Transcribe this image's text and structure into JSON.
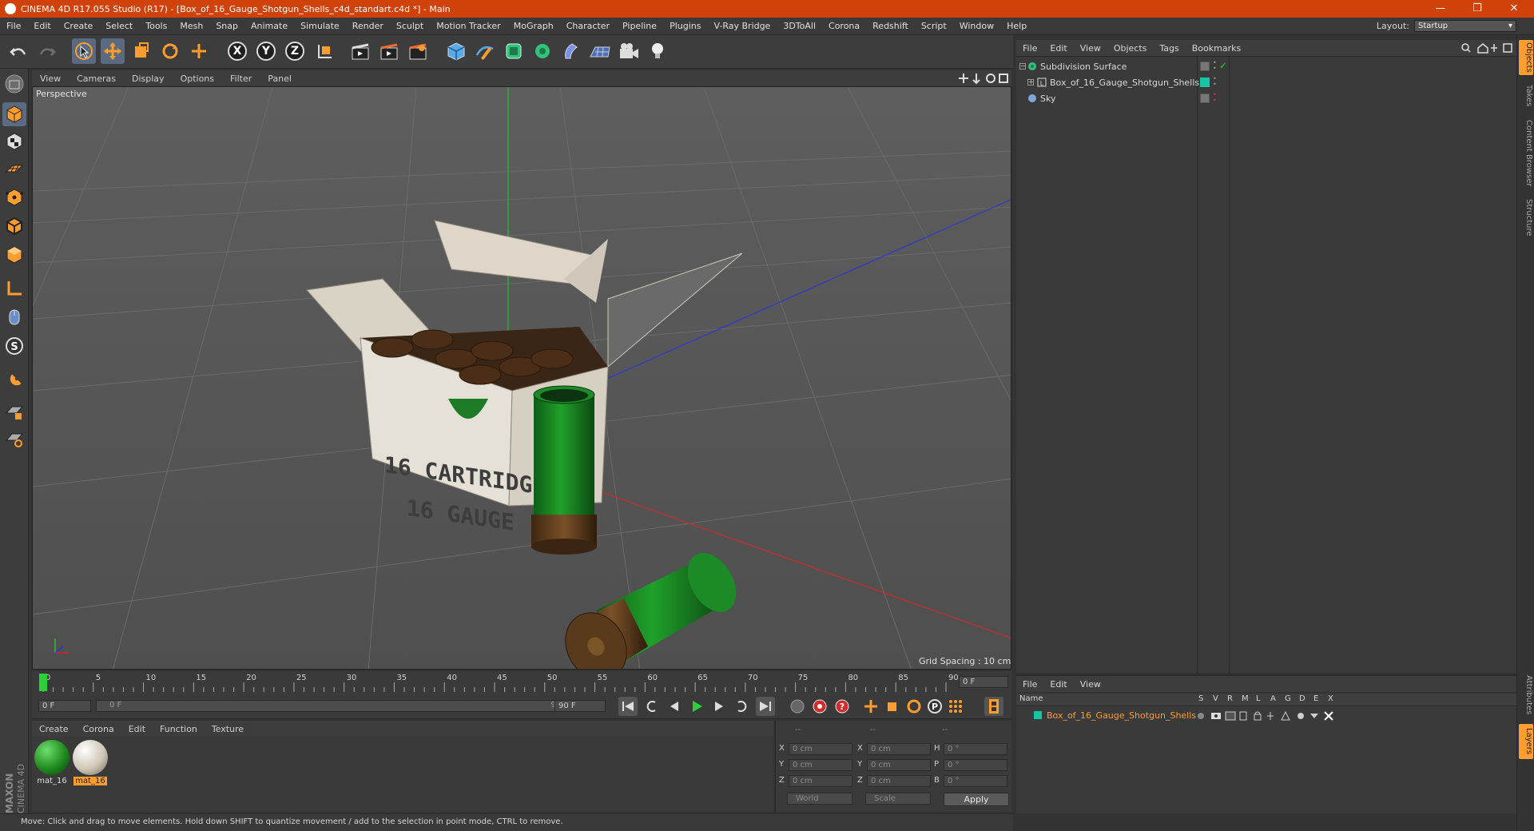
{
  "titlebar": {
    "title": "CINEMA 4D R17.055 Studio (R17) - [Box_of_16_Gauge_Shotgun_Shells_c4d_standart.c4d *] - Main",
    "minimize": "—",
    "restore": "❐",
    "close": "✕"
  },
  "menubar": {
    "items": [
      "File",
      "Edit",
      "Create",
      "Select",
      "Tools",
      "Mesh",
      "Snap",
      "Animate",
      "Simulate",
      "Render",
      "Sculpt",
      "Motion Tracker",
      "MoGraph",
      "Character",
      "Pipeline",
      "Plugins",
      "V-Ray Bridge",
      "3DToAll",
      "Corona",
      "Redshift",
      "Script",
      "Window",
      "Help"
    ],
    "layout_label": "Layout:",
    "layout_value": "Startup"
  },
  "viewport": {
    "menu": [
      "View",
      "Cameras",
      "Display",
      "Options",
      "Filter",
      "Panel"
    ],
    "label": "Perspective",
    "grid_spacing": "Grid Spacing : 10 cm",
    "box_text_1": "16 CARTRIDGES",
    "box_text_2": "16 GAUGE"
  },
  "timeline": {
    "ticks": [
      "0",
      "5",
      "10",
      "15",
      "20",
      "25",
      "30",
      "35",
      "40",
      "45",
      "50",
      "55",
      "60",
      "65",
      "70",
      "75",
      "80",
      "85",
      "90"
    ],
    "current_frame": "0 F",
    "start_field": "0 F",
    "range_start": "0 F",
    "range_end": "90 F",
    "end_field": "90 F"
  },
  "materials": {
    "menu": [
      "Create",
      "Corona",
      "Edit",
      "Function",
      "Texture"
    ],
    "items": [
      {
        "label": "mat_16",
        "color": "#1f8a1f",
        "selected": false
      },
      {
        "label": "mat_16",
        "color": "#cfc7b6",
        "selected": true
      }
    ]
  },
  "coordinates": {
    "headers": [
      "--",
      "--",
      "--"
    ],
    "rows": [
      {
        "a": "X",
        "av": "0 cm",
        "b": "X",
        "bv": "0 cm",
        "c": "H",
        "cv": "0 °"
      },
      {
        "a": "Y",
        "av": "0 cm",
        "b": "Y",
        "bv": "0 cm",
        "c": "P",
        "cv": "0 °"
      },
      {
        "a": "Z",
        "av": "0 cm",
        "b": "Z",
        "bv": "0 cm",
        "c": "B",
        "cv": "0 °"
      }
    ],
    "mode1": "World",
    "mode2": "Scale",
    "apply": "Apply"
  },
  "statusbar": {
    "text": "Move: Click and drag to move elements. Hold down SHIFT to quantize movement / add to the selection in point mode, CTRL to remove."
  },
  "object_manager": {
    "menu": [
      "File",
      "Edit",
      "View",
      "Objects",
      "Tags",
      "Bookmarks"
    ],
    "objects": [
      {
        "name": "Subdivision Surface",
        "indent": 0
      },
      {
        "name": "Box_of_16_Gauge_Shotgun_Shells",
        "indent": 1
      },
      {
        "name": "Sky",
        "indent": 0
      }
    ]
  },
  "layer_manager": {
    "menu": [
      "File",
      "Edit",
      "View"
    ],
    "columns": [
      "Name",
      "S",
      "V",
      "R",
      "M",
      "L",
      "A",
      "G",
      "D",
      "E",
      "X"
    ],
    "layers": [
      {
        "name": "Box_of_16_Gauge_Shotgun_Shells"
      }
    ]
  },
  "right_tabs": [
    "Objects",
    "Takes",
    "Content Browser",
    "Structure",
    "Attributes",
    "Layers"
  ],
  "maxon": {
    "line1": "MAXON",
    "line2": "CINEMA 4D"
  },
  "colors": {
    "title_bar": "#d1420a",
    "accent_orange": "#ff9d2f",
    "layer_teal": "#17c4a3",
    "x_axis": "#cc2a2a",
    "y_axis": "#2ac12a",
    "z_axis": "#2a3acc"
  }
}
